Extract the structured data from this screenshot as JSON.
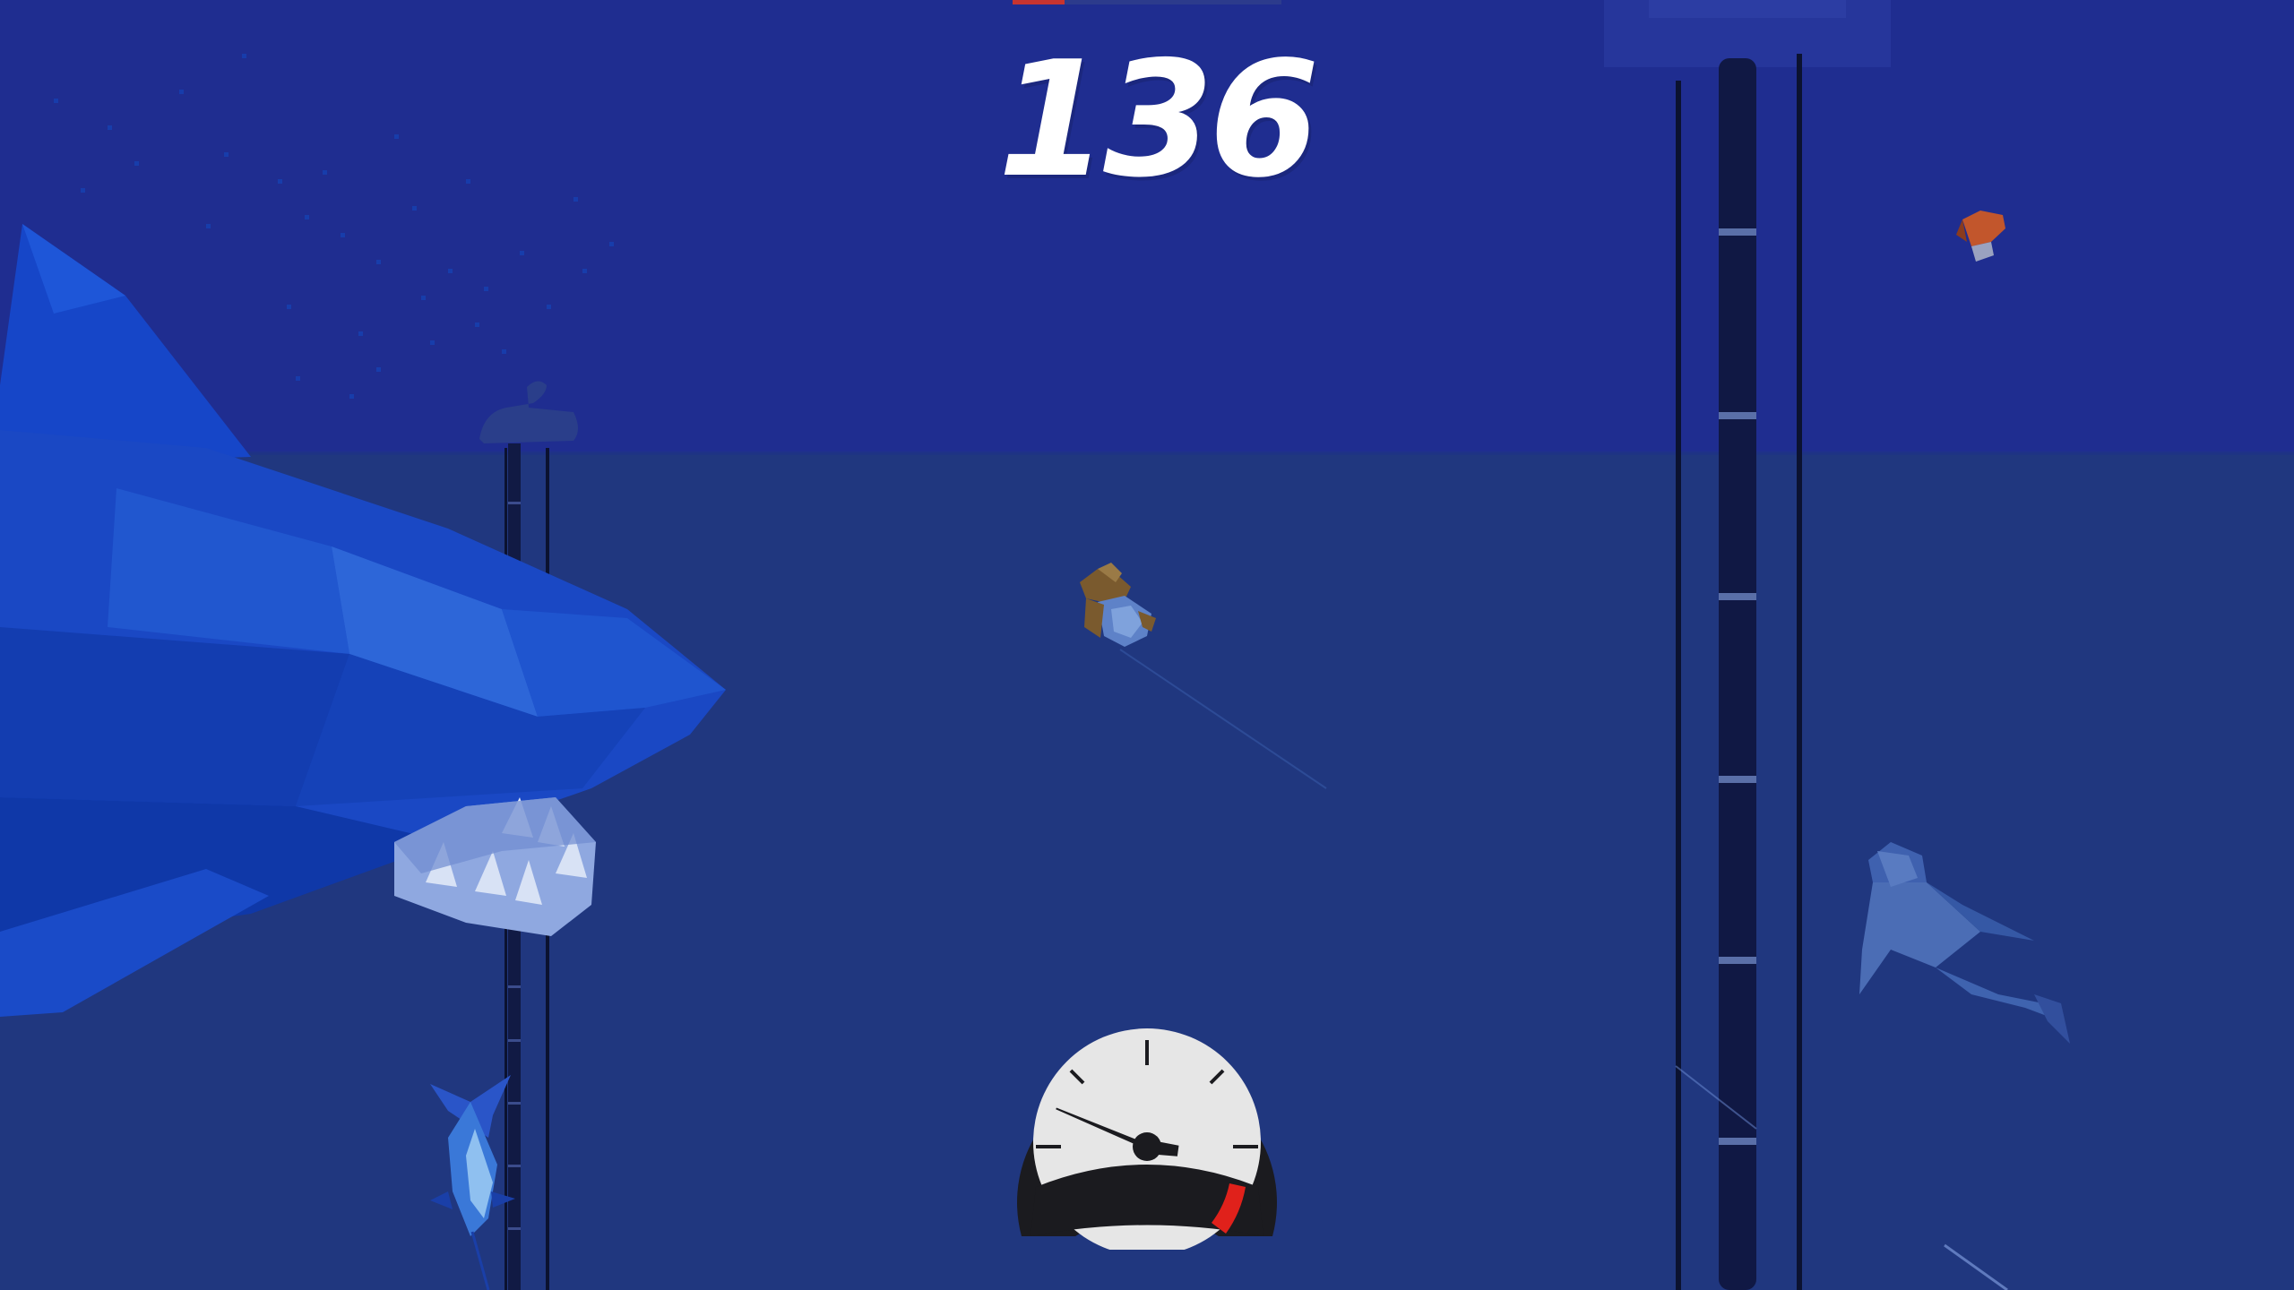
{
  "hud": {
    "score": "136",
    "speedometer": {
      "level": 0.22,
      "redline": true
    }
  },
  "colors": {
    "sky": "#1f2d90",
    "water": "#20377f",
    "shark_body": "#1a48c4",
    "shark_belly": "#8fa8e0",
    "pillar": "#0e1640",
    "score_text": "#ffffff",
    "gauge_red": "#e0211b"
  },
  "scene": {
    "player": "diver",
    "objects": [
      "giant-shark",
      "small-shark",
      "swordfish",
      "red-fish",
      "pillar-left",
      "pillar-right"
    ]
  }
}
